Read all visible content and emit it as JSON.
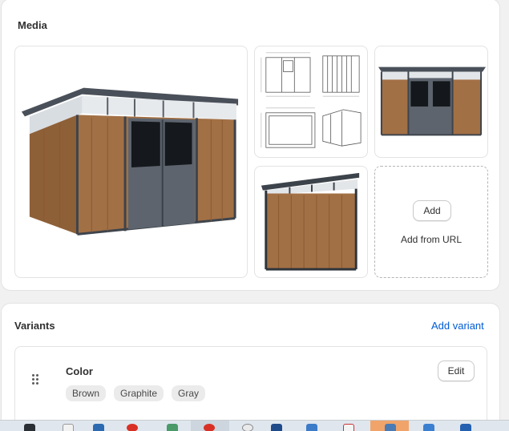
{
  "media": {
    "title": "Media",
    "add_label": "Add",
    "add_from_url_label": "Add from URL",
    "images": [
      {
        "name": "shed-front-view"
      },
      {
        "name": "shed-dimension-drawing"
      },
      {
        "name": "shed-back-view"
      },
      {
        "name": "shed-side-view"
      }
    ]
  },
  "variants": {
    "title": "Variants",
    "add_variant_label": "Add variant",
    "option": {
      "name": "Color",
      "edit_label": "Edit",
      "values": [
        "Brown",
        "Graphite",
        "Gray"
      ]
    }
  },
  "taskbar": {
    "icons": [
      "pinned-app-icon",
      "file-icon",
      "app-icon",
      "chrome-icon",
      "app-icon",
      "chrome-icon",
      "app-icon",
      "app-icon",
      "file-icon",
      "app-icon",
      "app-icon",
      "app-icon"
    ]
  },
  "colors": {
    "link": "#005bd3",
    "wood": "#9a6a40",
    "frame": "#474e58",
    "accent_active_app": "#f0a46a"
  }
}
